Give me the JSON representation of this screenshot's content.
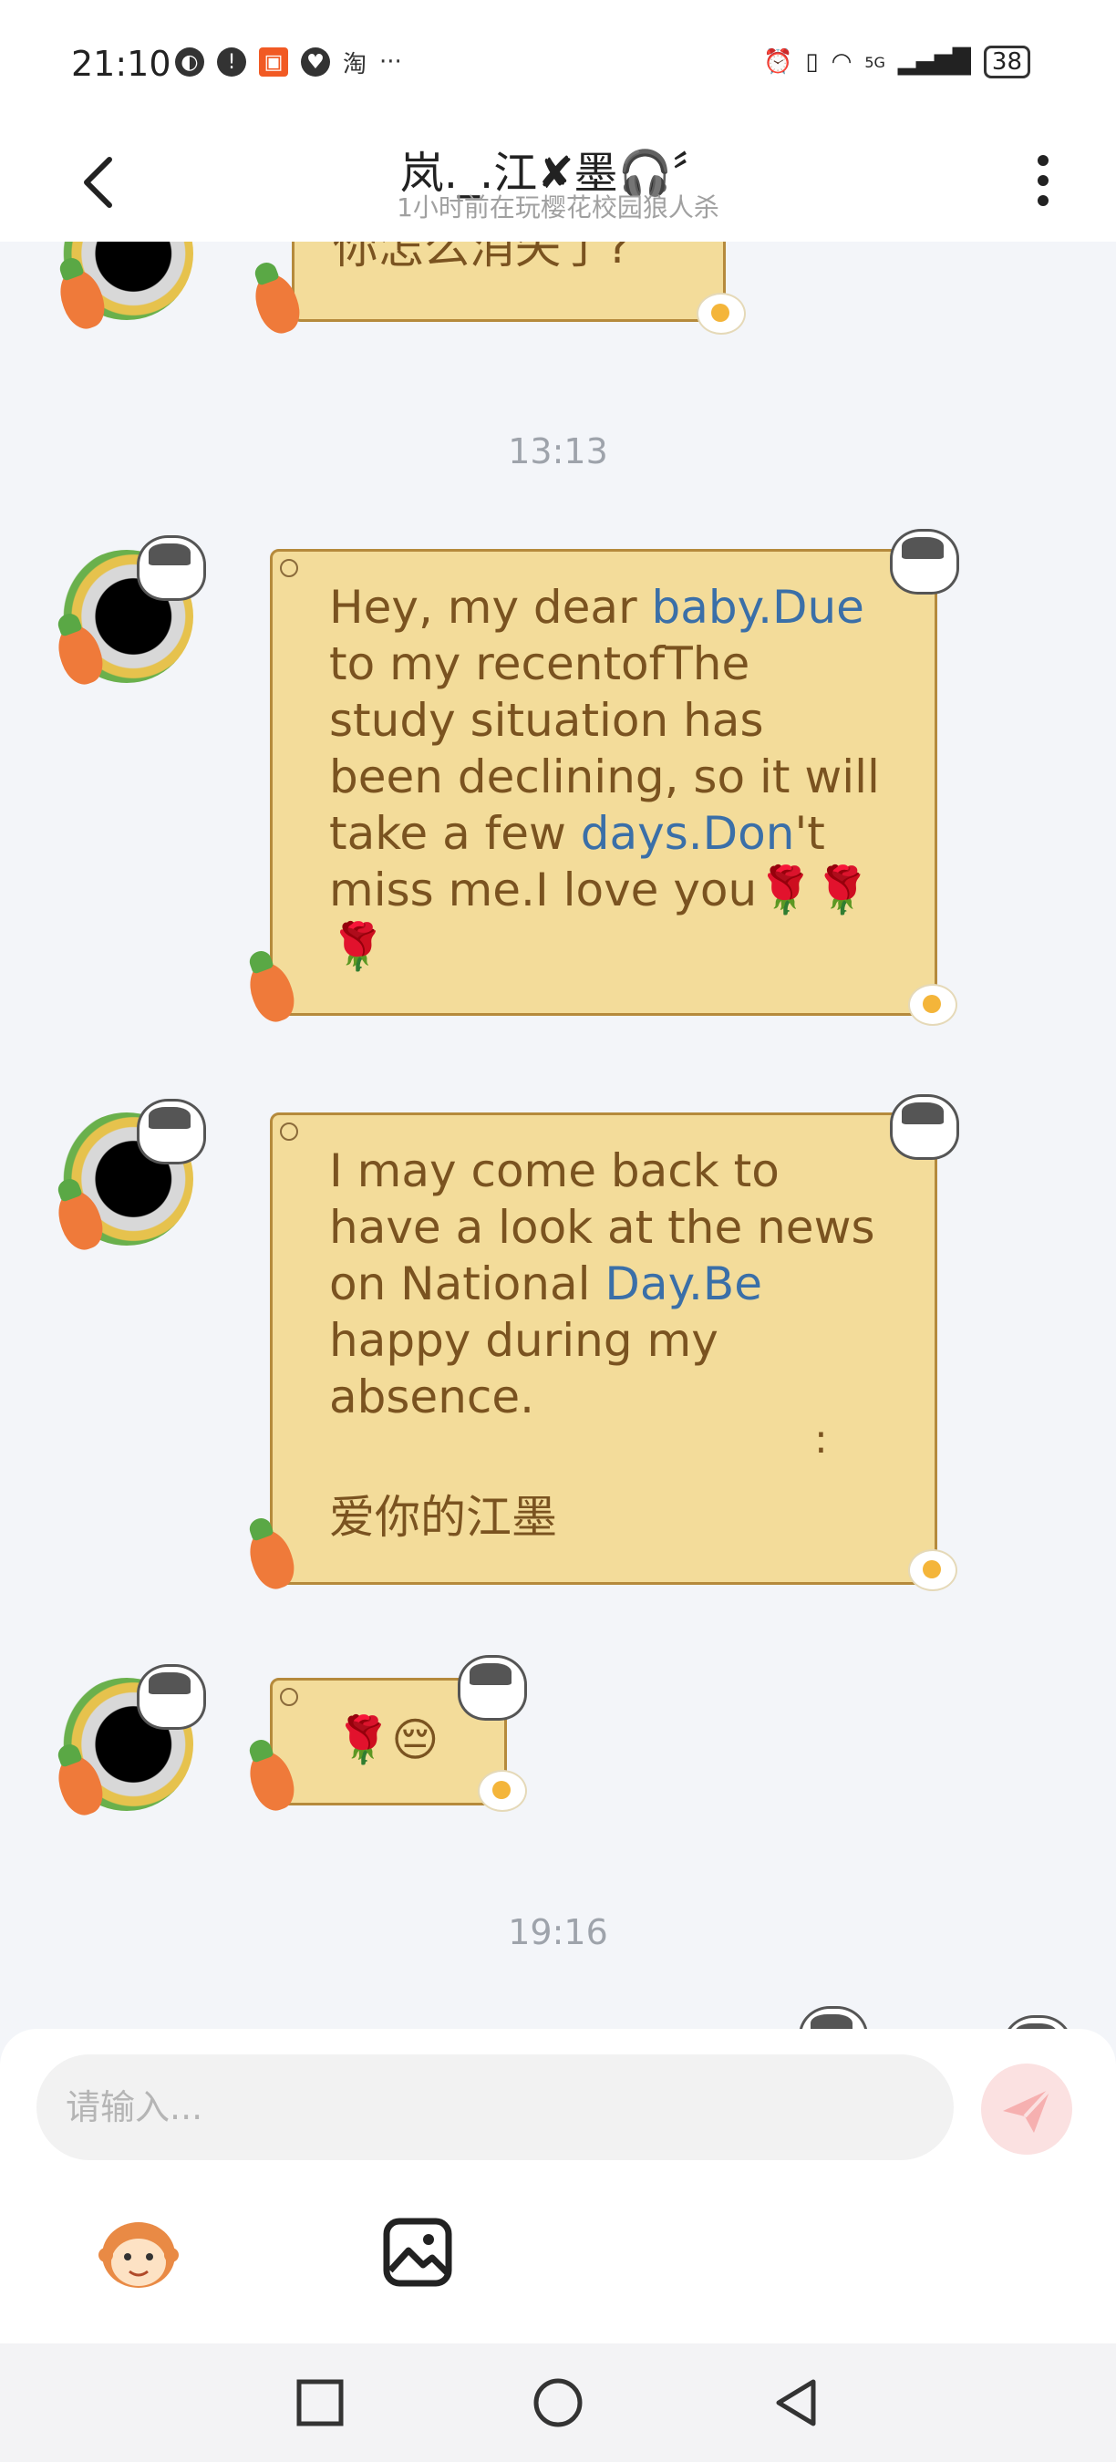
{
  "status_bar": {
    "time": "21:10",
    "left_icons": [
      "globe-icon",
      "alert-icon",
      "kuaishou-icon",
      "heart-icon",
      "taobao-icon",
      "more-dots-icon"
    ],
    "taobao_label": "淘",
    "dots_label": "···",
    "network_label": "5G",
    "battery": "38"
  },
  "header": {
    "title": "岚._.江✘墨🎧〞",
    "subtitle": "1小时前在玩樱花校园狼人杀"
  },
  "chat": {
    "partial_message": "你怎么消失了?",
    "timestamp_1": "13:13",
    "message_1": {
      "p1": "Hey, my dear ",
      "link1": "baby.Due",
      "p2": "\nto my recentofThe\nstudy situation has\nbeen declining, so it will\ntake a few ",
      "link2": "days.Don",
      "p3": "'t\nmiss me.I love you🌹🌹\n🌹"
    },
    "message_2": {
      "p1": "I may come back to\nhave a look at the news\non National ",
      "link1": "Day.Be",
      "p2": "\nhappy during my\nabsence.",
      "colon": ":",
      "signature": "爱你的江墨"
    },
    "message_3": "🌹😔",
    "timestamp_2": "19:16"
  },
  "input_bar": {
    "placeholder": "请输入...",
    "send_color": "#f6b0b0"
  },
  "colors": {
    "bubble_bg": "#f3dc9a",
    "bubble_border": "#b58a3c",
    "bubble_text": "#7a5320",
    "link": "#3a6fa8"
  }
}
